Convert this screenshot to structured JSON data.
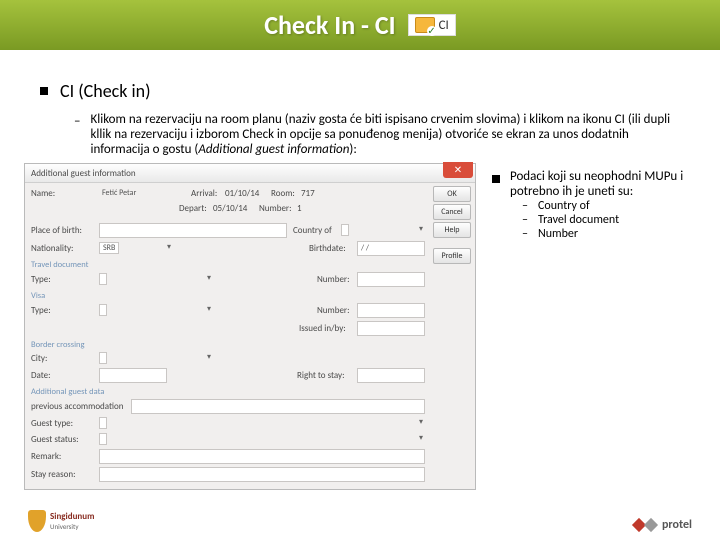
{
  "header": {
    "title": "Check In - CI",
    "badge_label": "CI"
  },
  "bullets": {
    "lvl1": "CI (Check in)",
    "lvl2_prefix": "Klikom na rezervaciju na room planu (naziv gosta će biti ispisano crvenim slovima) i klikom na ikonu CI (ili dupli kllik na rezervaciju i izborom Check in opcije sa ponuđenog menija) otvoriće se ekran za unos dodatnih informacija o gostu (",
    "lvl2_italic": "Additional guest information",
    "lvl2_suffix": "):"
  },
  "dialog": {
    "title": "Additional guest information",
    "labels": {
      "name": "Name:",
      "arrival": "Arrival:",
      "depart": "Depart:",
      "room": "Room:",
      "number_top": "Number:",
      "place": "Place of birth:",
      "country": "Country of",
      "nationality": "Nationality:",
      "birthdate": "Birthdate:",
      "travel_doc": "Travel document",
      "type": "Type:",
      "number": "Number:",
      "visa": "Visa",
      "visa_type": "Type:",
      "visa_number": "Number:",
      "issued": "Issued in/by:",
      "border": "Border crossing",
      "city": "City:",
      "date": "Date:",
      "right_to_stay": "Right to stay:",
      "addl": "Additional guest data",
      "prev_acc": "previous accommodation",
      "guest_type": "Guest type:",
      "guest_status": "Guest status:",
      "remark": "Remark:",
      "stay_reason": "Stay reason:"
    },
    "values": {
      "name": "Fetić Petar",
      "arrival": "01/10/14",
      "depart": "05/10/14",
      "room": "717",
      "number_top": "1",
      "nationality": "SRB",
      "birthdate": "/   /"
    },
    "buttons": {
      "ok": "OK",
      "cancel": "Cancel",
      "help": "Help",
      "profile": "Profile"
    }
  },
  "info": {
    "lead": "Podaci koji su neophodni MUPu i potrebno ih je uneti su:",
    "items": [
      "Country of",
      "Travel document",
      "Number"
    ]
  },
  "footer": {
    "left_name": "Singidunum",
    "left_sub": "University",
    "right": "protel"
  }
}
